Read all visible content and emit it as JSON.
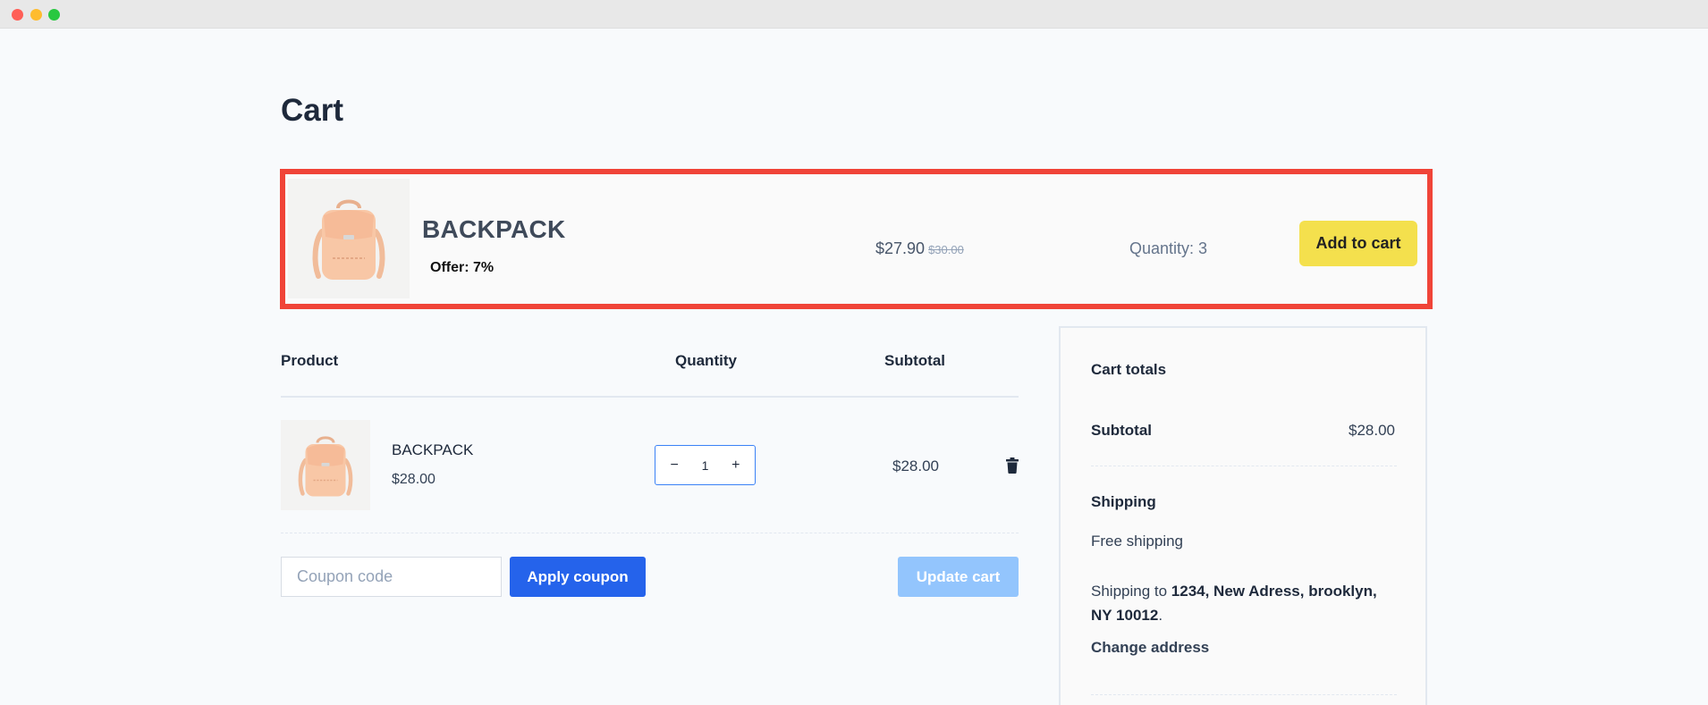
{
  "page": {
    "title": "Cart"
  },
  "promo": {
    "product_name": "BACKPACK",
    "offer": "Offer: 7%",
    "price": "$27.90",
    "old_price": "$30.00",
    "quantity": "Quantity: 3",
    "add_to_cart": "Add to cart",
    "highlight_color": "#f04438",
    "button_color": "#f4e04d"
  },
  "table": {
    "headers": {
      "product": "Product",
      "quantity": "Quantity",
      "subtotal": "Subtotal"
    },
    "rows": [
      {
        "name": "BACKPACK",
        "price": "$28.00",
        "quantity": "1",
        "subtotal": "$28.00"
      }
    ]
  },
  "stepper": {
    "minus": "−",
    "plus": "+"
  },
  "coupon": {
    "placeholder": "Coupon code",
    "apply_label": "Apply coupon"
  },
  "update_label": "Update cart",
  "totals": {
    "title": "Cart totals",
    "subtotal_label": "Subtotal",
    "subtotal_value": "$28.00",
    "shipping_label": "Shipping",
    "shipping_method": "Free shipping",
    "shipping_to_prefix": "Shipping to ",
    "shipping_address": "1234, New Adress, brooklyn, NY 10012",
    "shipping_to_suffix": ".",
    "change_address": "Change address"
  },
  "icons": {
    "product": "backpack-icon",
    "delete": "trash-icon"
  },
  "colors": {
    "accent": "#2563eb",
    "disabled_accent": "#93c5fd"
  }
}
